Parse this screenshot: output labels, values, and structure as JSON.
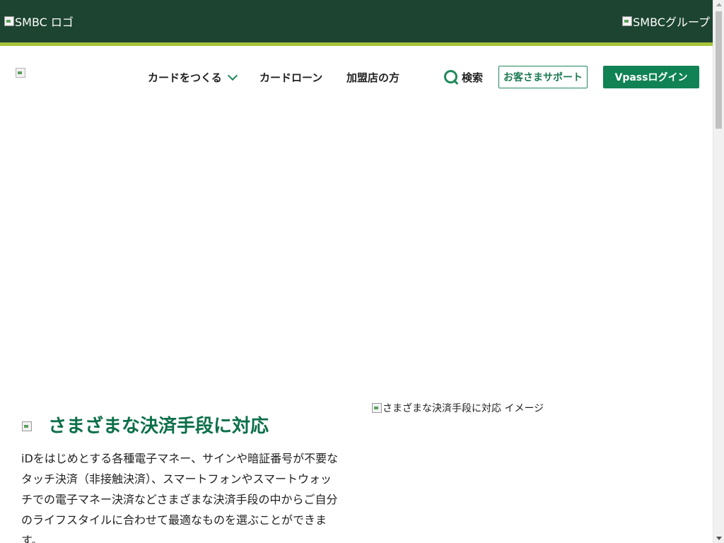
{
  "topbar": {
    "smbc_logo_alt": "SMBC ロゴ",
    "group_logo_alt": "SMBCグループ"
  },
  "nav": {
    "make_card": "カードをつくる",
    "card_loan": "カードローン",
    "merchant": "加盟店の方",
    "search": "検索",
    "support": "お客さまサポート",
    "vpass_login": "Vpassログイン"
  },
  "feature": {
    "title": "さまざまな決済手段に対応",
    "image_alt": "さまざまな決済手段に対応 イメージ",
    "body": "iDをはじめとする各種電子マネー、サインや暗証番号が不要なタッチ決済（非接触決済）、スマートフォンやスマートウォッチでの電子マネー決済などさまざまな決済手段の中からご自分のライフスタイルに合わせて最適なものを選ぶことができます。"
  },
  "colors": {
    "topbar": "#1c4431",
    "accent_line": "#a7c43a",
    "brand_green": "#108254",
    "title_green": "#0b6f49"
  },
  "icons": {
    "search": "search-icon",
    "chevron": "chevron-down-icon"
  }
}
